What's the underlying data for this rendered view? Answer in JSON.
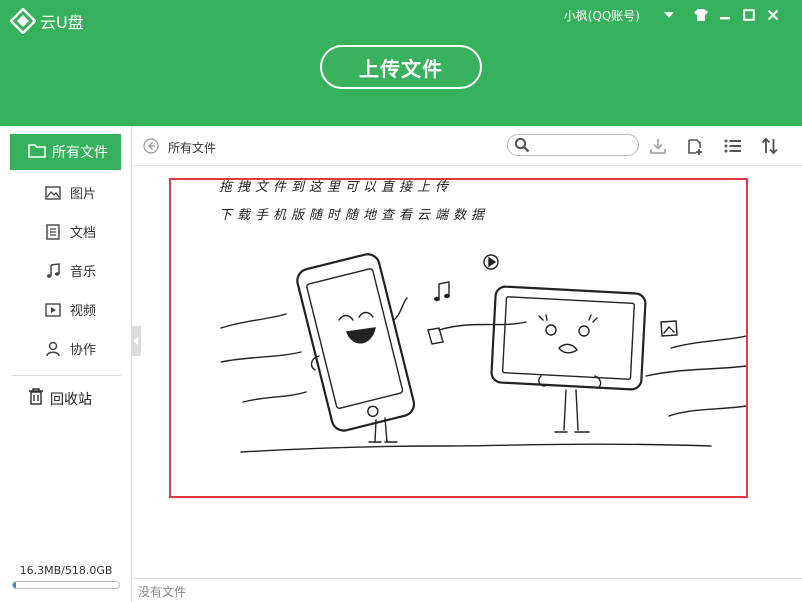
{
  "app": {
    "name": "云U盘",
    "user": "小枫(QQ账号)"
  },
  "header": {
    "upload_label": "上传文件"
  },
  "sidebar": {
    "active_label": "所有文件",
    "items": [
      {
        "label": "图片",
        "icon": "image-icon"
      },
      {
        "label": "文档",
        "icon": "document-icon"
      },
      {
        "label": "音乐",
        "icon": "music-icon"
      },
      {
        "label": "视频",
        "icon": "video-icon"
      },
      {
        "label": "协作",
        "icon": "person-icon"
      }
    ],
    "trash_label": "回收站",
    "storage_text": "16.3MB/518.0GB",
    "storage_used_fraction": 0.03
  },
  "toolbar": {
    "path": "所有文件",
    "search_placeholder": ""
  },
  "drop_area": {
    "hint_line1": "拖拽文件到这里可以直接上传",
    "hint_line2": "下载手机版随时随地查看云端数据"
  },
  "status": {
    "text": "没有文件"
  },
  "colors": {
    "brand_green": "#36b15b",
    "highlight_red": "#e5393f",
    "progress_blue": "#2a8fd8"
  }
}
